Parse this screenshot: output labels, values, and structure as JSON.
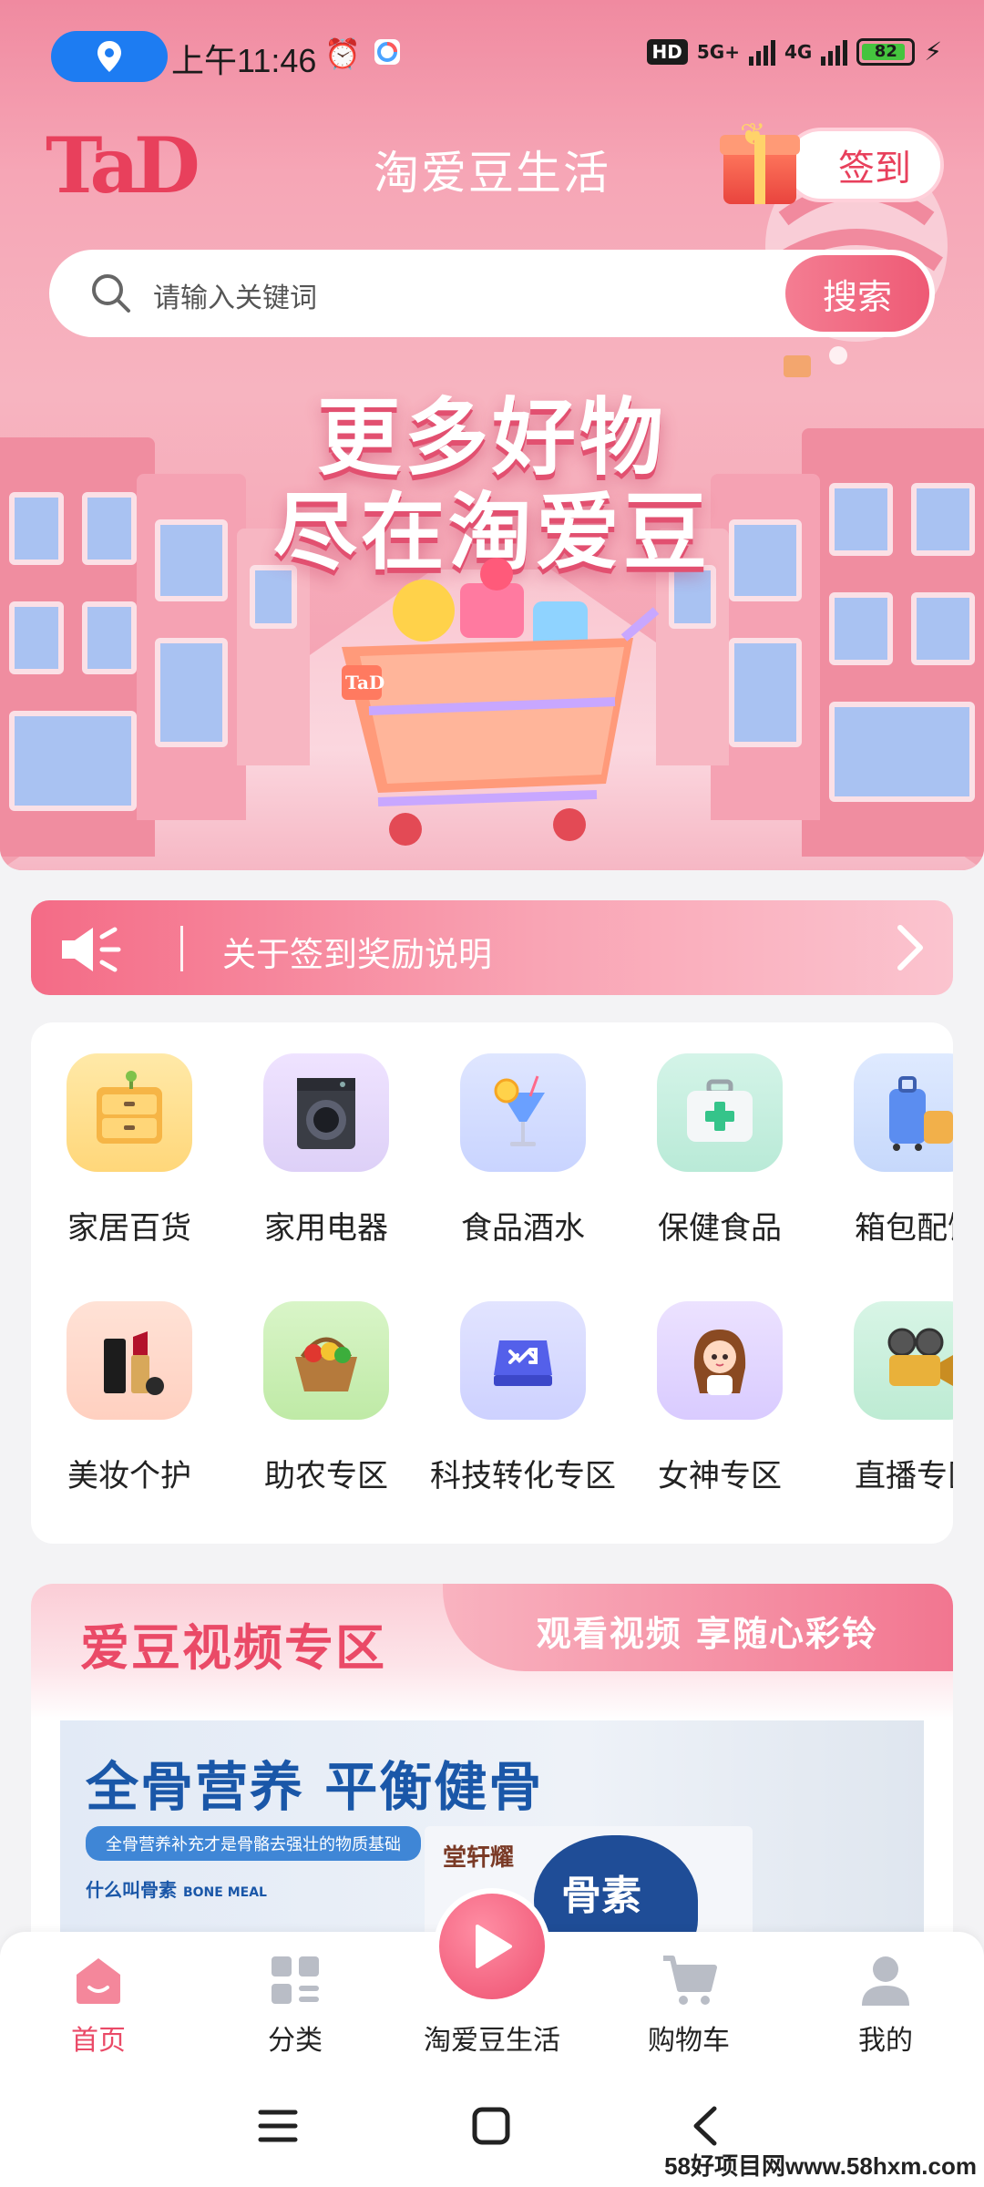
{
  "status_bar": {
    "time": "上午11:46",
    "hd": "HD",
    "net1": "5G+",
    "net2": "4G",
    "battery": "82"
  },
  "header": {
    "logo": "TaD",
    "title": "淘爱豆生活",
    "checkin_label": "签到"
  },
  "search": {
    "placeholder": "请输入关键词",
    "button_label": "搜索"
  },
  "banner": {
    "line1": "更多好物",
    "line2": "尽在淘爱豆"
  },
  "notice": {
    "text": "关于签到奖励说明"
  },
  "categories": [
    {
      "label": "家居百货",
      "icon": "cabinet-icon"
    },
    {
      "label": "家用电器",
      "icon": "washing-machine-icon"
    },
    {
      "label": "食品酒水",
      "icon": "drink-icon"
    },
    {
      "label": "保健食品",
      "icon": "first-aid-icon"
    },
    {
      "label": "箱包配饰",
      "icon": "luggage-icon"
    },
    {
      "label": "美妆个护",
      "icon": "lipstick-icon"
    },
    {
      "label": "助农专区",
      "icon": "vegetable-basket-icon"
    },
    {
      "label": "科技转化专区",
      "icon": "tech-icon"
    },
    {
      "label": "女神专区",
      "icon": "goddess-icon"
    },
    {
      "label": "直播专区",
      "icon": "camera-icon"
    }
  ],
  "video_zone": {
    "title": "爱豆视频专区",
    "subtitle": "观看视频 享随心彩铃",
    "ad_title": "全骨营养 平衡健骨",
    "ad_chip": "全骨营养补充才是骨骼去强壮的物质基础",
    "ad_sub": "什么叫骨素",
    "ad_sub_en": "BONE MEAL",
    "ad_brand": "堂轩耀",
    "ad_box_text": "骨素"
  },
  "bottom_nav": [
    {
      "label": "首页",
      "icon": "home-icon",
      "active": true
    },
    {
      "label": "分类",
      "icon": "grid-icon",
      "active": false
    },
    {
      "label": "淘爱豆生活",
      "icon": "play-icon",
      "active": false
    },
    {
      "label": "购物车",
      "icon": "cart-icon",
      "active": false
    },
    {
      "label": "我的",
      "icon": "user-icon",
      "active": false
    }
  ],
  "watermark": "58好项目网www.58hxm.com",
  "colors": {
    "brand": "#ea4a67",
    "accent": "#f47d92",
    "location_pill": "#1d7cf2"
  }
}
